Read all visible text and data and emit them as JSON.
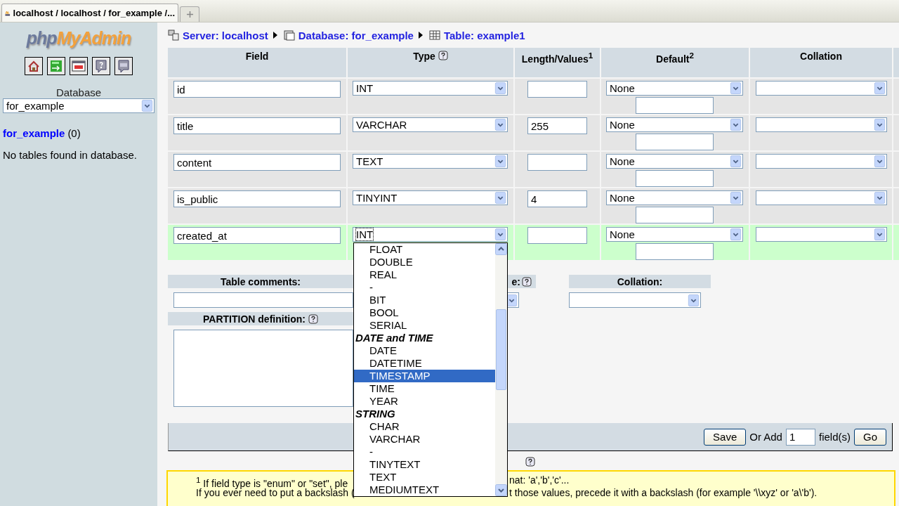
{
  "browser_tab": {
    "title": "localhost / localhost / for_example /...",
    "selected": true
  },
  "sidebar": {
    "logo": [
      "php",
      "MyAdmin"
    ],
    "database_label": "Database",
    "database_select": "for_example",
    "db_link": "for_example",
    "db_count": "(0)",
    "message": "No tables found in database."
  },
  "breadcrumbs": [
    "Server: localhost",
    "Database: for_example",
    "Table: example1"
  ],
  "table": {
    "columns": [
      "Field",
      "Type",
      "Length/Values$^{1}$",
      "Default$^{2}$",
      "Collation"
    ],
    "rows": [
      {
        "field": "id",
        "type": "INT",
        "length": "",
        "default": "None",
        "selected": false
      },
      {
        "field": "title",
        "type": "VARCHAR",
        "length": "255",
        "default": "None",
        "selected": false
      },
      {
        "field": "content",
        "type": "TEXT",
        "length": "",
        "default": "None",
        "selected": false
      },
      {
        "field": "is_public",
        "type": "TINYINT",
        "length": "4",
        "default": "None",
        "selected": false
      },
      {
        "field": "created_at",
        "type": "INT",
        "length": "",
        "default": "None",
        "selected": true
      }
    ]
  },
  "type_dropdown": {
    "items": [
      {
        "kind": "option",
        "label": "FLOAT",
        "selected": false
      },
      {
        "kind": "option",
        "label": "DOUBLE",
        "selected": false
      },
      {
        "kind": "option",
        "label": "REAL",
        "selected": false
      },
      {
        "kind": "option",
        "label": "-",
        "selected": false
      },
      {
        "kind": "option",
        "label": "BIT",
        "selected": false
      },
      {
        "kind": "option",
        "label": "BOOL",
        "selected": false
      },
      {
        "kind": "option",
        "label": "SERIAL",
        "selected": false
      },
      {
        "kind": "group",
        "label": "DATE and TIME"
      },
      {
        "kind": "option",
        "label": "DATE",
        "selected": false
      },
      {
        "kind": "option",
        "label": "DATETIME",
        "selected": false
      },
      {
        "kind": "option",
        "label": "TIMESTAMP",
        "selected": true
      },
      {
        "kind": "option",
        "label": "TIME",
        "selected": false
      },
      {
        "kind": "option",
        "label": "YEAR",
        "selected": false
      },
      {
        "kind": "group",
        "label": "STRING"
      },
      {
        "kind": "option",
        "label": "CHAR",
        "selected": false
      },
      {
        "kind": "option",
        "label": "VARCHAR",
        "selected": false
      },
      {
        "kind": "option",
        "label": "-",
        "selected": false
      },
      {
        "kind": "option",
        "label": "TINYTEXT",
        "selected": false
      },
      {
        "kind": "option",
        "label": "TEXT",
        "selected": false
      },
      {
        "kind": "option",
        "label": "MEDIUMTEXT",
        "selected": false
      }
    ]
  },
  "table_options": {
    "comments_label": "Table comments:",
    "engine_label_visible": "e:",
    "collation_label": "Collation:",
    "partition_label": "PARTITION definition:"
  },
  "footer": {
    "save": "Save",
    "or_add": "Or Add",
    "add_count": "1",
    "fields_label": "field(s)",
    "go": "Go"
  },
  "notes": [
    {
      "left": "$^{1}$ If field type is \"enum\" or \"set\", ple",
      "right": "nat: 'a','b','c'..."
    },
    {
      "left": "If you ever need to put a backslash (",
      "right": "t those values, precede it with a backslash (for example '\\\\xyz' or 'a\\'b')."
    }
  ]
}
